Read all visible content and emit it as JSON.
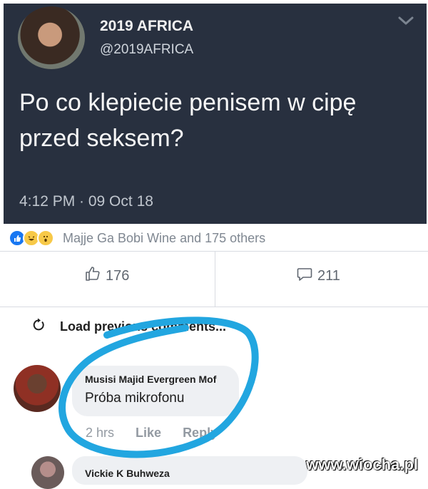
{
  "tweet": {
    "name": "2019 AFRICA",
    "handle": "@2019AFRICA",
    "text": "Po co klepiecie penisem w cipę przed seksem?",
    "time": "4:12 PM · 09 Oct 18"
  },
  "reactions": {
    "label": "Majje Ga Bobi Wine and 175 others"
  },
  "actions": {
    "likes": "176",
    "comments": "211"
  },
  "comments": {
    "load_previous": "Load previous comments...",
    "items": [
      {
        "name": "Musisi Majid Evergreen Mof",
        "text": "Próba mikrofonu",
        "time": "2 hrs",
        "like": "Like",
        "reply": "Reply"
      },
      {
        "name": "Vickie K Buhweza"
      }
    ]
  },
  "watermark": "www.wiocha.pl",
  "colors": {
    "tweet_bg": "#28303f",
    "highlight": "#22a6e0"
  }
}
